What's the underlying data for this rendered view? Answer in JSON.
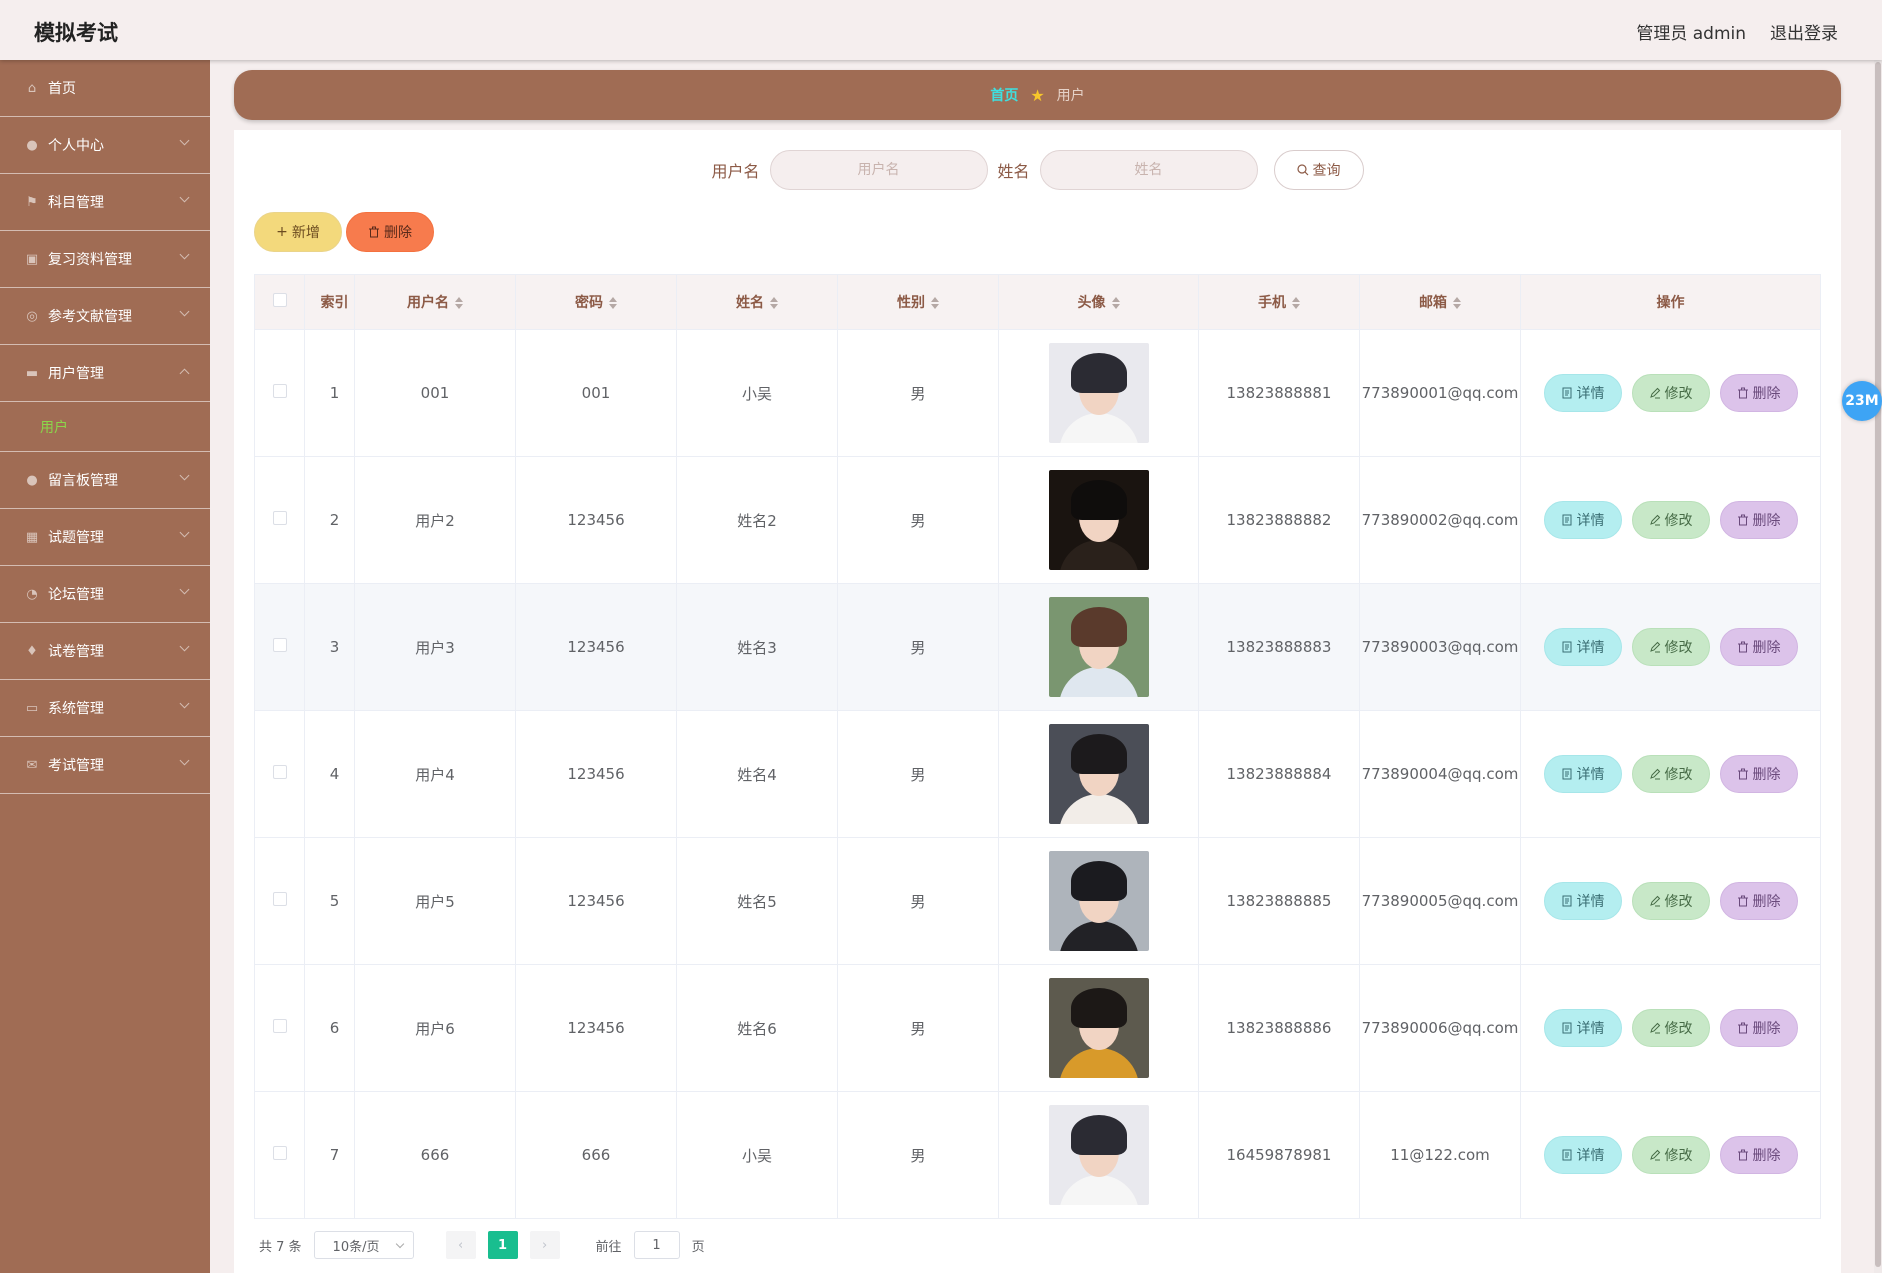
{
  "app": {
    "title": "模拟考试"
  },
  "header": {
    "user": "管理员 admin",
    "logout": "退出登录"
  },
  "sidebar": {
    "items": [
      {
        "label": "首页",
        "icon": "home-icon",
        "arrow": false
      },
      {
        "label": "个人中心",
        "icon": "user-icon",
        "arrow": true
      },
      {
        "label": "科目管理",
        "icon": "flag-icon",
        "arrow": true
      },
      {
        "label": "复习资料管理",
        "icon": "clipboard-icon",
        "arrow": true
      },
      {
        "label": "参考文献管理",
        "icon": "compass-icon",
        "arrow": true
      },
      {
        "label": "用户管理",
        "icon": "stamp-icon",
        "arrow": true,
        "expanded": true
      },
      {
        "label": "留言板管理",
        "icon": "user-icon",
        "arrow": true
      },
      {
        "label": "试题管理",
        "icon": "grid-icon",
        "arrow": true
      },
      {
        "label": "论坛管理",
        "icon": "gauge-icon",
        "arrow": true
      },
      {
        "label": "试卷管理",
        "icon": "mic-icon",
        "arrow": true
      },
      {
        "label": "系统管理",
        "icon": "chat-icon",
        "arrow": true
      },
      {
        "label": "考试管理",
        "icon": "mail-icon",
        "arrow": true
      }
    ],
    "sub_item": "用户"
  },
  "breadcrumb": {
    "home": "首页",
    "current": "用户"
  },
  "search": {
    "username_label": "用户名",
    "username_placeholder": "用户名",
    "name_label": "姓名",
    "name_placeholder": "姓名",
    "query": "查询"
  },
  "actions": {
    "add": "新增",
    "delete": "删除"
  },
  "table": {
    "headers": [
      "索引",
      "用户名",
      "密码",
      "姓名",
      "性别",
      "头像",
      "手机",
      "邮箱",
      "操作"
    ],
    "rows": [
      {
        "index": "1",
        "username": "001",
        "password": "001",
        "name": "小吴",
        "gender": "男",
        "phone": "13823888881",
        "email": "773890001@qq.com",
        "avatar": "avatar-boy-1"
      },
      {
        "index": "2",
        "username": "用户2",
        "password": "123456",
        "name": "姓名2",
        "gender": "男",
        "phone": "13823888882",
        "email": "773890002@qq.com",
        "avatar": "avatar-boy-2"
      },
      {
        "index": "3",
        "username": "用户3",
        "password": "123456",
        "name": "姓名3",
        "gender": "男",
        "phone": "13823888883",
        "email": "773890003@qq.com",
        "avatar": "avatar-girl-1"
      },
      {
        "index": "4",
        "username": "用户4",
        "password": "123456",
        "name": "姓名4",
        "gender": "男",
        "phone": "13823888884",
        "email": "773890004@qq.com",
        "avatar": "avatar-girl-2"
      },
      {
        "index": "5",
        "username": "用户5",
        "password": "123456",
        "name": "姓名5",
        "gender": "男",
        "phone": "13823888885",
        "email": "773890005@qq.com",
        "avatar": "avatar-girl-3"
      },
      {
        "index": "6",
        "username": "用户6",
        "password": "123456",
        "name": "姓名6",
        "gender": "男",
        "phone": "13823888886",
        "email": "773890006@qq.com",
        "avatar": "avatar-girl-4"
      },
      {
        "index": "7",
        "username": "666",
        "password": "666",
        "name": "小吴",
        "gender": "男",
        "phone": "16459878981",
        "email": "11@122.com",
        "avatar": "avatar-boy-1"
      }
    ],
    "row_actions": {
      "detail": "详情",
      "edit": "修改",
      "delete": "删除"
    }
  },
  "pagination": {
    "total": "共 7 条",
    "page_size": "10条/页",
    "current_page": "1",
    "goto_label": "前往",
    "goto_value": "1",
    "page_unit": "页"
  },
  "badge": {
    "text": "23M"
  },
  "colors": {
    "sidebar_bg": "#a06c54",
    "header_bg": "#f5eeee",
    "breadcrumb_home": "#3ee0e0",
    "add_button": "#f3d97c",
    "delete_button": "#f77b4d",
    "detail_button": "#b4eef0",
    "edit_button": "#c8e8c8",
    "row_delete_button": "#dcc3ea",
    "pager_active": "#19be8f"
  }
}
